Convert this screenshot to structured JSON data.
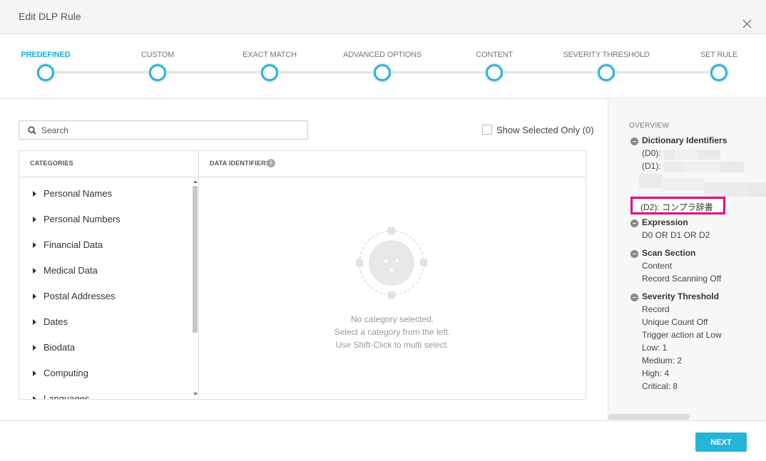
{
  "dialog": {
    "title": "Edit DLP Rule"
  },
  "stepper": {
    "steps": [
      {
        "label": "PREDEFINED",
        "active": true
      },
      {
        "label": "CUSTOM",
        "active": false
      },
      {
        "label": "EXACT MATCH",
        "active": false
      },
      {
        "label": "ADVANCED OPTIONS",
        "active": false
      },
      {
        "label": "CONTENT",
        "active": false
      },
      {
        "label": "SEVERITY THRESHOLD",
        "active": false
      },
      {
        "label": "SET RULE",
        "active": false
      }
    ]
  },
  "search": {
    "placeholder": "Search",
    "value": ""
  },
  "show_selected": {
    "label": "Show Selected Only (0)",
    "checked": false
  },
  "categories": {
    "header": "CATEGORIES",
    "items": [
      "Personal Names",
      "Personal Numbers",
      "Financial Data",
      "Medical Data",
      "Postal Addresses",
      "Dates",
      "Biodata",
      "Computing",
      "Languages"
    ]
  },
  "data_identifiers": {
    "header": "DATA IDENTIFIERS",
    "info_icon": "info-icon",
    "empty_lines": [
      "No category selected.",
      "Select a category from the left.",
      "Use Shift-Click to multi select."
    ]
  },
  "overview": {
    "title": "OVERVIEW",
    "dictionary": {
      "heading": "Dictionary Identifiers",
      "d0": "(D0): ",
      "d1": "(D1): ",
      "d2": "(D2): コンプラ辞書"
    },
    "expression": {
      "heading": "Expression",
      "value": "D0 OR D1 OR D2"
    },
    "scan_section": {
      "heading": "Scan Section",
      "lines": [
        "Content",
        "Record Scanning Off"
      ]
    },
    "severity": {
      "heading": "Severity Threshold",
      "lines": [
        "Record",
        "Unique Count Off",
        "Trigger action at Low",
        "Low: 1",
        "Medium: 2",
        "High: 4",
        "Critical: 8"
      ]
    }
  },
  "footer": {
    "next_label": "NEXT"
  },
  "colors": {
    "accent": "#25b4d8",
    "highlight": "#e6007e"
  }
}
